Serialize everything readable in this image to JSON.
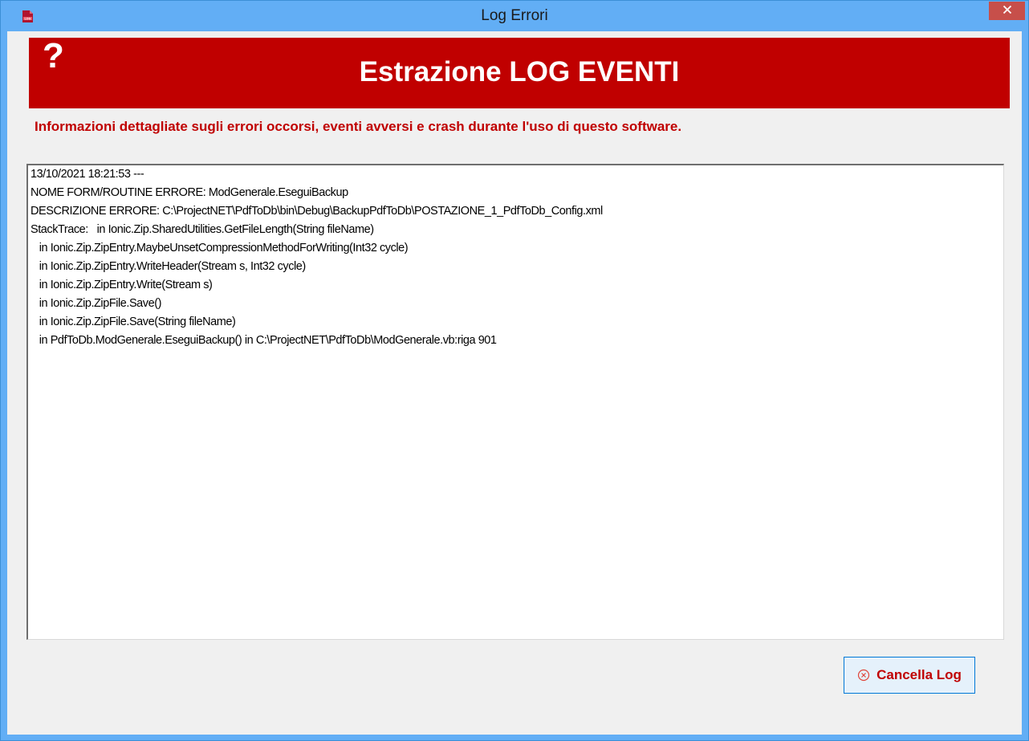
{
  "window": {
    "title": "Log Errori",
    "app_icon": "log-file-icon",
    "close_icon": "close-icon",
    "accent_color": "#62aef5"
  },
  "banner": {
    "symbol": "?",
    "title": "Estrazione LOG EVENTI",
    "background_color": "#c00000"
  },
  "subtitle": "Informazioni dettagliate sugli errori occorsi, eventi avversi e crash durante l'uso di questo software.",
  "log": {
    "lines": [
      "13/10/2021 18:21:53 ---",
      "NOME FORM/ROUTINE ERRORE: ModGenerale.EseguiBackup",
      "DESCRIZIONE ERRORE: C:\\ProjectNET\\PdfToDb\\bin\\Debug\\BackupPdfToDb\\POSTAZIONE_1_PdfToDb_Config.xml",
      "StackTrace:   in Ionic.Zip.SharedUtilities.GetFileLength(String fileName)",
      "   in Ionic.Zip.ZipEntry.MaybeUnsetCompressionMethodForWriting(Int32 cycle)",
      "   in Ionic.Zip.ZipEntry.WriteHeader(Stream s, Int32 cycle)",
      "   in Ionic.Zip.ZipEntry.Write(Stream s)",
      "   in Ionic.Zip.ZipFile.Save()",
      "   in Ionic.Zip.ZipFile.Save(String fileName)",
      "   in PdfToDb.ModGenerale.EseguiBackup() in C:\\ProjectNET\\PdfToDb\\ModGenerale.vb:riga 901"
    ]
  },
  "buttons": {
    "cancel_log_label": "Cancella Log",
    "cancel_log_icon": "cancel-circle-icon"
  }
}
